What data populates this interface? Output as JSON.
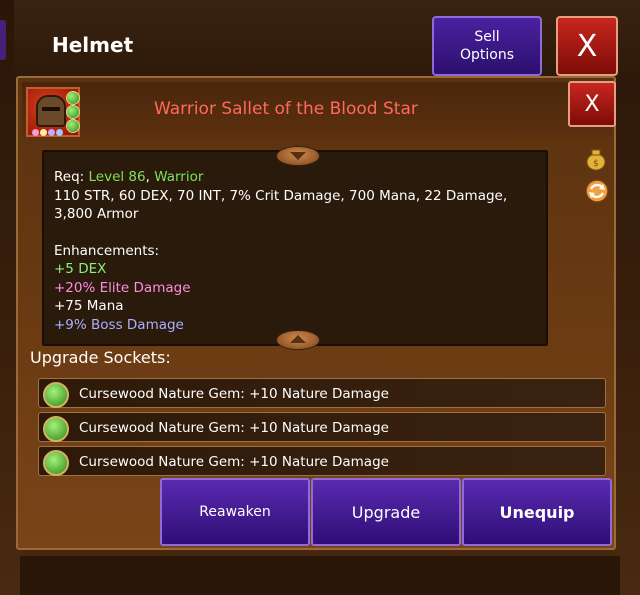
{
  "window": {
    "title": "Helmet",
    "sell_options_label": [
      "Sell",
      "Options"
    ],
    "close_label": "X"
  },
  "item": {
    "name": "Warrior Sallet of the Blood Star",
    "close_label": "X",
    "requirements": {
      "prefix": "Req:",
      "level": "Level 86",
      "separator": ",",
      "class": "Warrior"
    },
    "base_stats": "110 STR, 60 DEX, 70 INT, 7% Crit Damage, 700 Mana, 22 Damage, 3,800 Armor",
    "enhancements_title": "Enhancements:",
    "enhancements": [
      {
        "text": "+5 DEX",
        "color": "#8cf07a"
      },
      {
        "text": "+20% Elite Damage",
        "color": "#ff8ce0"
      },
      {
        "text": "+75 Mana",
        "color": "#ffffff"
      },
      {
        "text": "+9% Boss Damage",
        "color": "#aab0ff"
      }
    ]
  },
  "sockets": {
    "title": "Upgrade Sockets:",
    "items": [
      {
        "label": "Cursewood Nature Gem: +10 Nature Damage"
      },
      {
        "label": "Cursewood Nature Gem: +10 Nature Damage"
      },
      {
        "label": "Cursewood Nature Gem: +10 Nature Damage"
      }
    ]
  },
  "actions": {
    "reawaken": "Reawaken",
    "upgrade": "Upgrade",
    "unequip": "Unequip"
  },
  "colors": {
    "item_name": "#ff6a5a",
    "level": "#7fe05a",
    "button_purple": "#4a22a0",
    "close_red": "#c8261e"
  },
  "icons": [
    "item-helmet-icon",
    "gold-pouch-icon",
    "transmute-icon",
    "nature-gem-icon",
    "scroll-up-icon",
    "scroll-down-icon"
  ]
}
